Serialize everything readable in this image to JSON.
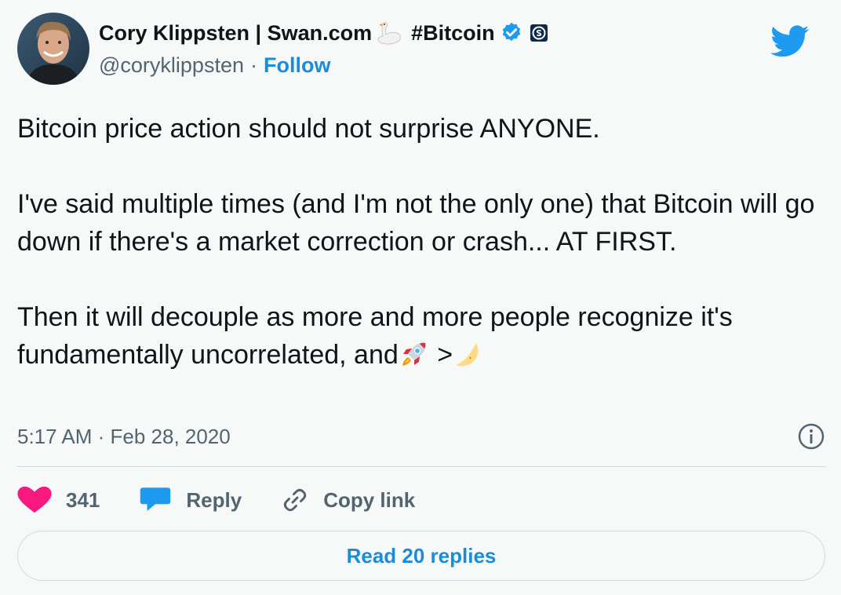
{
  "author": {
    "display_name": "Cory Klippsten | Swan.com",
    "hashtag": "#Bitcoin",
    "handle": "@coryklippsten",
    "separator": "·",
    "follow_label": "Follow"
  },
  "tweet": {
    "line1": "Bitcoin price action should not surprise ANYONE.",
    "para2": "I've said multiple times (and I'm not the only one) that Bitcoin will go down if there's a market correction or crash...  AT FIRST.",
    "para3_before": "Then it will decouple as more and more people recognize it's fundamentally uncorrelated, and",
    "para3_mid": " >",
    "emojis": [
      "swan",
      "rocket",
      "crescent-moon"
    ]
  },
  "meta": {
    "timestamp": "5:17 AM · Feb 28, 2020"
  },
  "actions": {
    "like_count": "341",
    "reply_label": "Reply",
    "copy_link_label": "Copy link"
  },
  "footer": {
    "read_replies_label": "Read 20 replies"
  },
  "colors": {
    "background": "#f7f9f9",
    "text": "#0f1419",
    "secondary": "#536471",
    "link": "#1a8cd8",
    "twitter_blue": "#1d9bf0",
    "like": "#f91880"
  }
}
